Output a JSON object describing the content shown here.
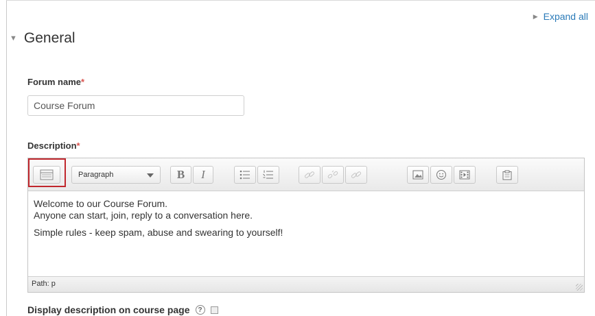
{
  "header": {
    "expand_all": "Expand all"
  },
  "section": {
    "title": "General"
  },
  "forum_name": {
    "label": "Forum name",
    "required_mark": "*",
    "value": "Course Forum"
  },
  "description": {
    "label": "Description",
    "required_mark": "*",
    "toolbar": {
      "paragraph_select": "Paragraph",
      "bold": "B",
      "italic": "I"
    },
    "content": [
      "Welcome to our Course Forum.",
      "Anyone can start, join, reply to a conversation here.",
      "Simple rules - keep spam, abuse and swearing to yourself!"
    ],
    "path_text": "Path: p"
  },
  "display_description": {
    "label": "Display description on course page",
    "help": "?"
  },
  "colors": {
    "link": "#2a7ab8",
    "required": "#d9534f",
    "highlight_box": "#c0262c"
  }
}
